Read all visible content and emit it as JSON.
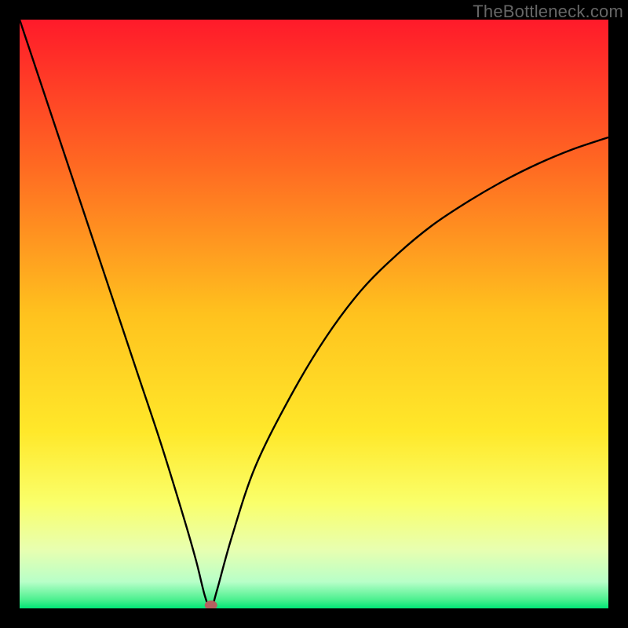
{
  "attribution": "TheBottleneck.com",
  "chart_data": {
    "type": "line",
    "title": "",
    "xlabel": "",
    "ylabel": "",
    "xlim": [
      0,
      100
    ],
    "ylim": [
      0,
      100
    ],
    "grid": false,
    "background": "rainbow-gradient-red-to-green",
    "annotations": [
      {
        "name": "vertex-marker",
        "x": 32.5,
        "y": 0,
        "color": "#b56060"
      }
    ],
    "series": [
      {
        "name": "bottleneck-curve",
        "x": [
          0,
          4,
          8,
          12,
          16,
          20,
          24,
          28,
          30,
          31.5,
          32.5,
          33.5,
          36,
          40,
          46,
          52,
          58,
          64,
          70,
          76,
          82,
          88,
          94,
          100
        ],
        "y": [
          100,
          88,
          76,
          64,
          52,
          40,
          28,
          15,
          8,
          2,
          0,
          3,
          12,
          24,
          36,
          46,
          54,
          60,
          65,
          69,
          72.5,
          75.5,
          78,
          80
        ]
      }
    ]
  },
  "colors": {
    "gradient_stops": [
      {
        "offset": 0,
        "color": "#ff1a2a"
      },
      {
        "offset": 0.25,
        "color": "#ff6a22"
      },
      {
        "offset": 0.5,
        "color": "#ffc21e"
      },
      {
        "offset": 0.7,
        "color": "#ffe82a"
      },
      {
        "offset": 0.82,
        "color": "#faff6a"
      },
      {
        "offset": 0.9,
        "color": "#e8ffb0"
      },
      {
        "offset": 0.955,
        "color": "#b8ffc8"
      },
      {
        "offset": 0.985,
        "color": "#4df090"
      },
      {
        "offset": 1.0,
        "color": "#00e676"
      }
    ],
    "curve": "#000000",
    "marker": "#b56060"
  }
}
